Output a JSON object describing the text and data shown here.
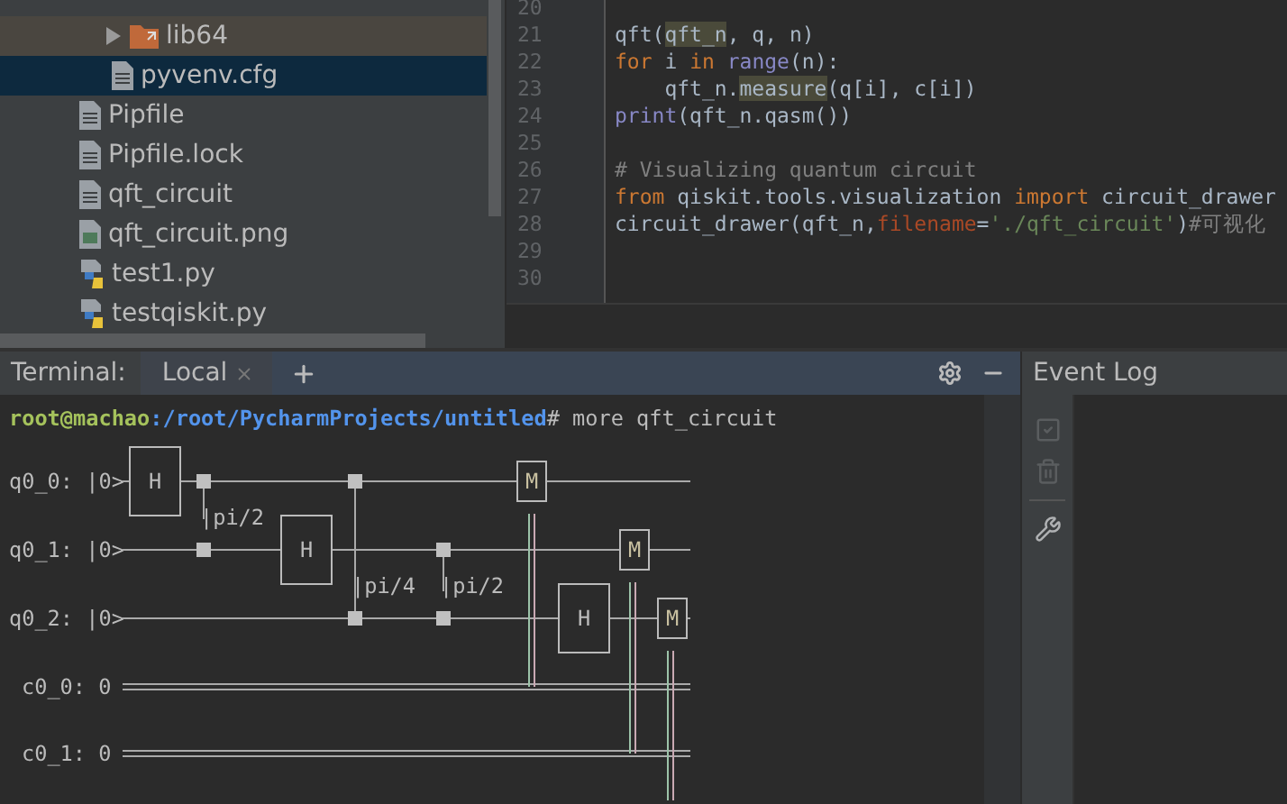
{
  "project_tree": [
    {
      "children": [
        {
          "label": "lib64",
          "kind": "folder",
          "selected": false,
          "expanded": false,
          "excluded": true
        },
        {
          "label": "pyvenv.cfg",
          "kind": "text",
          "selected": true,
          "excluded": false
        }
      ]
    },
    {
      "label": "Pipfile",
      "kind": "text",
      "selected": false,
      "excluded": false
    },
    {
      "label": "Pipfile.lock",
      "kind": "text",
      "selected": false,
      "excluded": false
    },
    {
      "label": "qft_circuit",
      "kind": "text",
      "selected": false,
      "excluded": false
    },
    {
      "label": "qft_circuit.png",
      "kind": "image",
      "selected": false,
      "excluded": false
    },
    {
      "label": "test1.py",
      "kind": "python",
      "selected": false,
      "excluded": false
    },
    {
      "label": "testqiskit.py",
      "kind": "python",
      "selected": false,
      "excluded": false
    }
  ],
  "editor": {
    "lines": [
      {
        "number": "20"
      },
      {
        "number": "21",
        "tokens": [
          {
            "text": "qft(",
            "kind": "plain"
          },
          {
            "text": "qft_n",
            "kind": "highlight"
          },
          {
            "text": ", q, n)",
            "kind": "plain"
          }
        ]
      },
      {
        "number": "22",
        "tokens": [
          {
            "text": "for",
            "kind": "keyword"
          },
          {
            "text": " i ",
            "kind": "plain"
          },
          {
            "text": "in",
            "kind": "keyword"
          },
          {
            "text": " range",
            "kind": "builtin"
          },
          {
            "text": "(n):",
            "kind": "plain"
          }
        ]
      },
      {
        "number": "23",
        "tokens": [
          {
            "text": "    qft_n.",
            "kind": "plain"
          },
          {
            "text": "measure",
            "kind": "highlight"
          },
          {
            "text": "(q[i], c[i])",
            "kind": "plain"
          }
        ]
      },
      {
        "number": "24",
        "tokens": [
          {
            "text": "print",
            "kind": "builtin"
          },
          {
            "text": "(qft_n.qasm())",
            "kind": "plain"
          }
        ]
      },
      {
        "number": "25"
      },
      {
        "number": "26",
        "tokens": [
          {
            "text": "# Visualizing quantum circuit",
            "kind": "comment"
          }
        ]
      },
      {
        "number": "27",
        "tokens": [
          {
            "text": "from",
            "kind": "keyword"
          },
          {
            "text": " qiskit.tools.visualization ",
            "kind": "plain"
          },
          {
            "text": "import",
            "kind": "keyword"
          },
          {
            "text": " circuit_drawer",
            "kind": "plain"
          }
        ]
      },
      {
        "number": "28",
        "tokens": [
          {
            "text": "circuit_drawer(qft_n,",
            "kind": "plain"
          },
          {
            "text": "filename",
            "kind": "param"
          },
          {
            "text": "=",
            "kind": "plain"
          },
          {
            "text": "'./qft_circuit'",
            "kind": "string"
          },
          {
            "text": ")",
            "kind": "plain"
          },
          {
            "text": "#可视化",
            "kind": "comment"
          }
        ]
      },
      {
        "number": "29"
      },
      {
        "number": "30"
      }
    ]
  },
  "terminal": {
    "title": "Terminal:",
    "tabs": [
      {
        "label": "Local",
        "selected": true
      }
    ],
    "prompt": {
      "user": "root@machao",
      "path": ":/root/PycharmProjects/untitled",
      "command": "# more qft_circuit"
    },
    "circuit": {
      "wires": [
        {
          "label": "q0_0: |0>",
          "kind": "quantum"
        },
        {
          "label": "q0_1: |0>",
          "kind": "quantum"
        },
        {
          "label": "q0_2: |0>",
          "kind": "quantum"
        },
        {
          "label": "c0_0: 0",
          "kind": "classical"
        },
        {
          "label": "c0_1: 0",
          "kind": "classical"
        }
      ],
      "gates": [
        {
          "label": "H",
          "kind": "hadamard"
        },
        {
          "label": "M",
          "kind": "measure"
        },
        {
          "label": "H",
          "kind": "hadamard"
        },
        {
          "label": "M",
          "kind": "measure"
        },
        {
          "label": "H",
          "kind": "hadamard"
        },
        {
          "label": "M",
          "kind": "measure"
        }
      ],
      "phases": [
        "|pi/2",
        "|pi/4",
        "|pi/2"
      ]
    }
  },
  "event_log": {
    "title": "Event Log"
  }
}
